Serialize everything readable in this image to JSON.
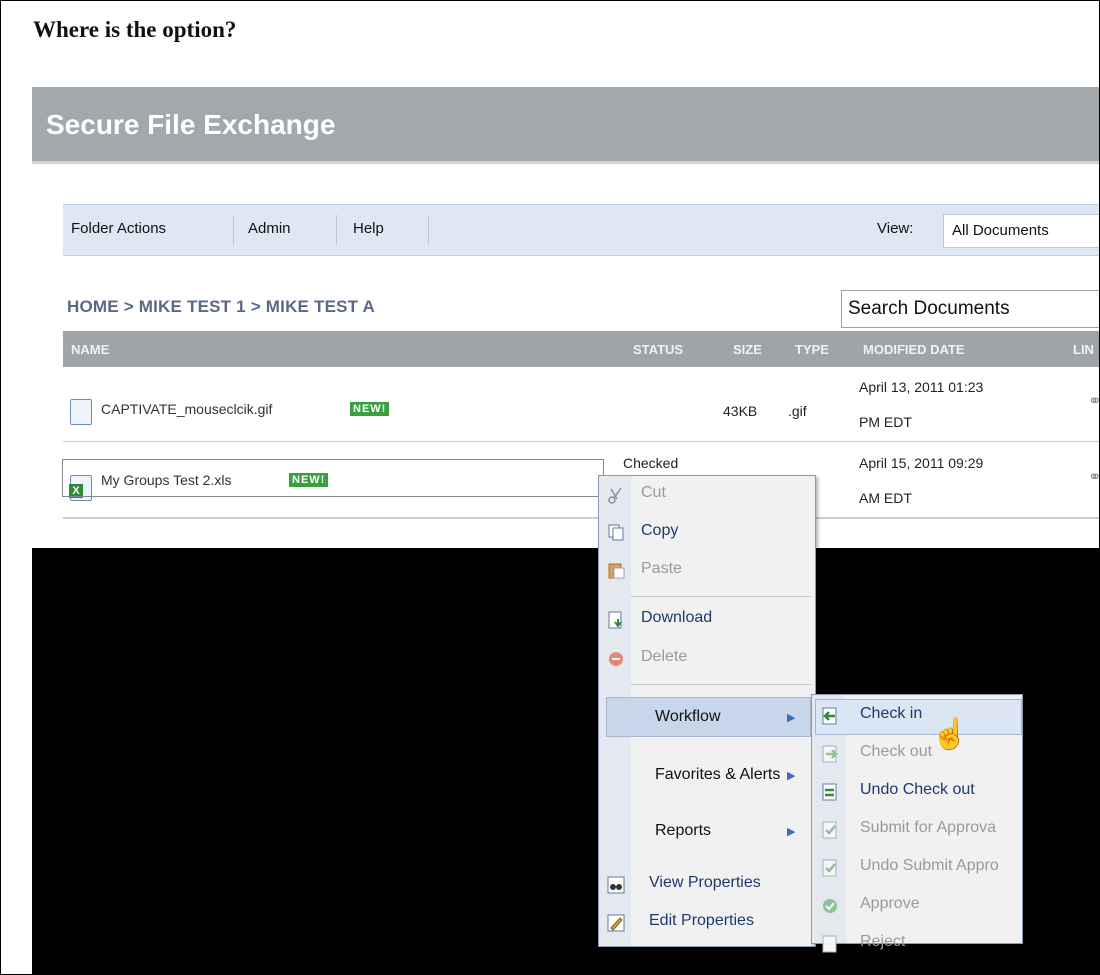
{
  "question": "Where is the option?",
  "app_title": "Secure File Exchange",
  "menubar": {
    "items": [
      "Folder Actions",
      "Admin",
      "Help"
    ],
    "view_label": "View:",
    "view_value": "All Documents"
  },
  "breadcrumb": "HOME > MIKE TEST 1 > MIKE TEST A",
  "search_placeholder": "Search Documents",
  "table": {
    "headers": [
      "NAME",
      "STATUS",
      "SIZE",
      "TYPE",
      "MODIFIED DATE",
      "LIN"
    ],
    "rows": [
      {
        "name": "CAPTIVATE_mouseclcik.gif",
        "badge": "NEW!",
        "status": "",
        "size": "43KB",
        "type": ".gif",
        "date_line1": "April 13, 2011 01:23",
        "date_line2": "PM EDT"
      },
      {
        "name": "My Groups Test 2.xls",
        "badge": "NEW!",
        "status": "Checked",
        "size": "",
        "type": "",
        "date_line1": "April 15, 2011 09:29",
        "date_line2": "AM EDT"
      }
    ]
  },
  "context_menu": {
    "items": [
      {
        "label": "Cut",
        "enabled": false,
        "icon": "scissors-icon"
      },
      {
        "label": "Copy",
        "enabled": true,
        "icon": "copy-icon"
      },
      {
        "label": "Paste",
        "enabled": false,
        "icon": "paste-icon"
      },
      {
        "label": "Download",
        "enabled": true,
        "icon": "download-icon"
      },
      {
        "label": "Delete",
        "enabled": false,
        "icon": "delete-icon"
      },
      {
        "label": "Workflow",
        "enabled": true,
        "submenu": true,
        "highlighted": true
      },
      {
        "label": "Favorites & Alerts",
        "enabled": true,
        "submenu": true
      },
      {
        "label": "Reports",
        "enabled": true,
        "submenu": true
      },
      {
        "label": "View Properties",
        "enabled": true,
        "icon": "binoculars-icon"
      },
      {
        "label": "Edit Properties",
        "enabled": true,
        "icon": "edit-icon"
      }
    ]
  },
  "workflow_submenu": {
    "items": [
      {
        "label": "Check in",
        "enabled": true,
        "hovered": true
      },
      {
        "label": "Check out",
        "enabled": false
      },
      {
        "label": "Undo Check out",
        "enabled": true
      },
      {
        "label": "Submit for Approva",
        "enabled": false
      },
      {
        "label": "Undo Submit Appro",
        "enabled": false
      },
      {
        "label": "Approve",
        "enabled": false
      },
      {
        "label": "Reject",
        "enabled": false
      }
    ]
  },
  "colors": {
    "banner": "#a3a8ad",
    "menubar": "#dde8f4",
    "table_header": "#9fa4a9",
    "new_badge": "#38a13d",
    "menu_enabled_text": "#1d3a6e",
    "menu_disabled_text": "#9a9a9a"
  }
}
